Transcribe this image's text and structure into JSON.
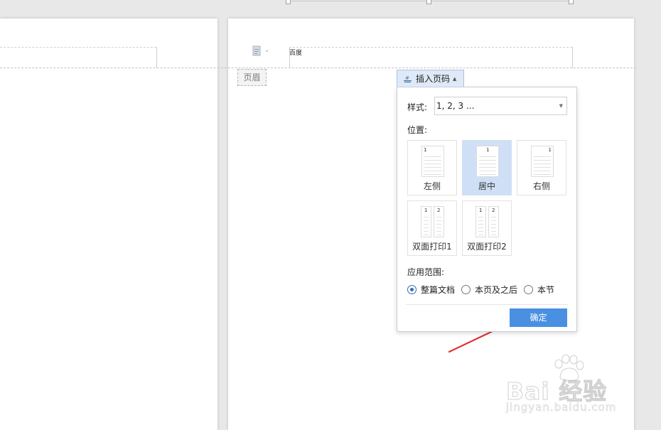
{
  "document": {
    "header_text": "百度",
    "header_badge": "页眉"
  },
  "insert_page_number": {
    "label": "插入页码",
    "style": {
      "label": "样式:",
      "value": "1, 2, 3 ..."
    },
    "position": {
      "label": "位置:",
      "options": [
        {
          "label": "左侧",
          "selected": false
        },
        {
          "label": "居中",
          "selected": true
        },
        {
          "label": "右侧",
          "selected": false
        },
        {
          "label": "双面打印1",
          "selected": false
        },
        {
          "label": "双面打印2",
          "selected": false
        }
      ]
    },
    "scope": {
      "label": "应用范围:",
      "options": [
        {
          "label": "整篇文档",
          "checked": true
        },
        {
          "label": "本页及之后",
          "checked": false
        },
        {
          "label": "本节",
          "checked": false
        }
      ]
    },
    "confirm_label": "确定"
  },
  "watermark": {
    "brand": "Bai  经验",
    "url": "jingyan.baidu.com"
  },
  "colors": {
    "accent": "#4a90e2",
    "selected_bg": "#cfe0f6",
    "arrow": "#e03030"
  },
  "icons": {
    "document": "document-icon",
    "insert": "insert-page-number-icon",
    "paw": "baidu-paw-icon"
  }
}
